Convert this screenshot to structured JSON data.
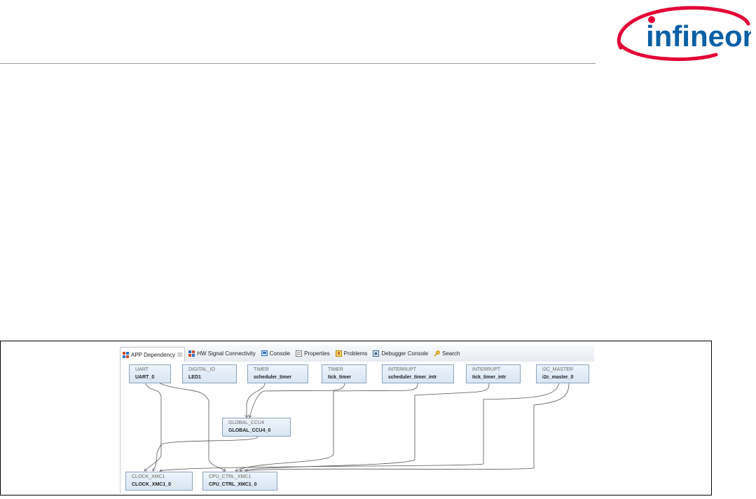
{
  "brand": {
    "logo_text": "infineon",
    "red": "#e30034",
    "blue": "#0a5fa7"
  },
  "tabs": [
    {
      "label": "APP Dependency",
      "icon": "app-dependency-icon",
      "active": true
    },
    {
      "label": "HW Signal Connectivity",
      "icon": "hw-signal-icon"
    },
    {
      "label": "Console",
      "icon": "console-icon"
    },
    {
      "label": "Properties",
      "icon": "properties-icon"
    },
    {
      "label": "Problems",
      "icon": "problems-icon"
    },
    {
      "label": "Debugger Console",
      "icon": "debugger-console-icon"
    },
    {
      "label": "Search",
      "icon": "search-icon"
    }
  ],
  "tab_close_glyph": "☒",
  "nodes": [
    {
      "id": "uart",
      "type": "UART",
      "name": "UART_0"
    },
    {
      "id": "digital_io",
      "type": "DIGITAL_IO",
      "name": "LED1"
    },
    {
      "id": "timer1",
      "type": "TIMER",
      "name": "scheduler_timer"
    },
    {
      "id": "timer2",
      "type": "TIMER",
      "name": "tick_timer"
    },
    {
      "id": "interrupt1",
      "type": "INTERRUPT",
      "name": "scheduler_timer_intr"
    },
    {
      "id": "interrupt2",
      "type": "INTERRUPT",
      "name": "tick_timer_intr"
    },
    {
      "id": "i2c",
      "type": "I2C_MASTER",
      "name": "i2c_master_0"
    },
    {
      "id": "global_ccu4",
      "type": "GLOBAL_CCU4",
      "name": "GLOBAL_CCU4_0"
    },
    {
      "id": "clock",
      "type": "CLOCK_XMC1",
      "name": "CLOCK_XMC1_0"
    },
    {
      "id": "cpu",
      "type": "CPU_CTRL_XMC1",
      "name": "CPU_CTRL_XMC1_0"
    }
  ],
  "colors": {
    "node_border": "#8aa3bf",
    "node_fill": "#dde8f5",
    "connector": "#555555"
  }
}
